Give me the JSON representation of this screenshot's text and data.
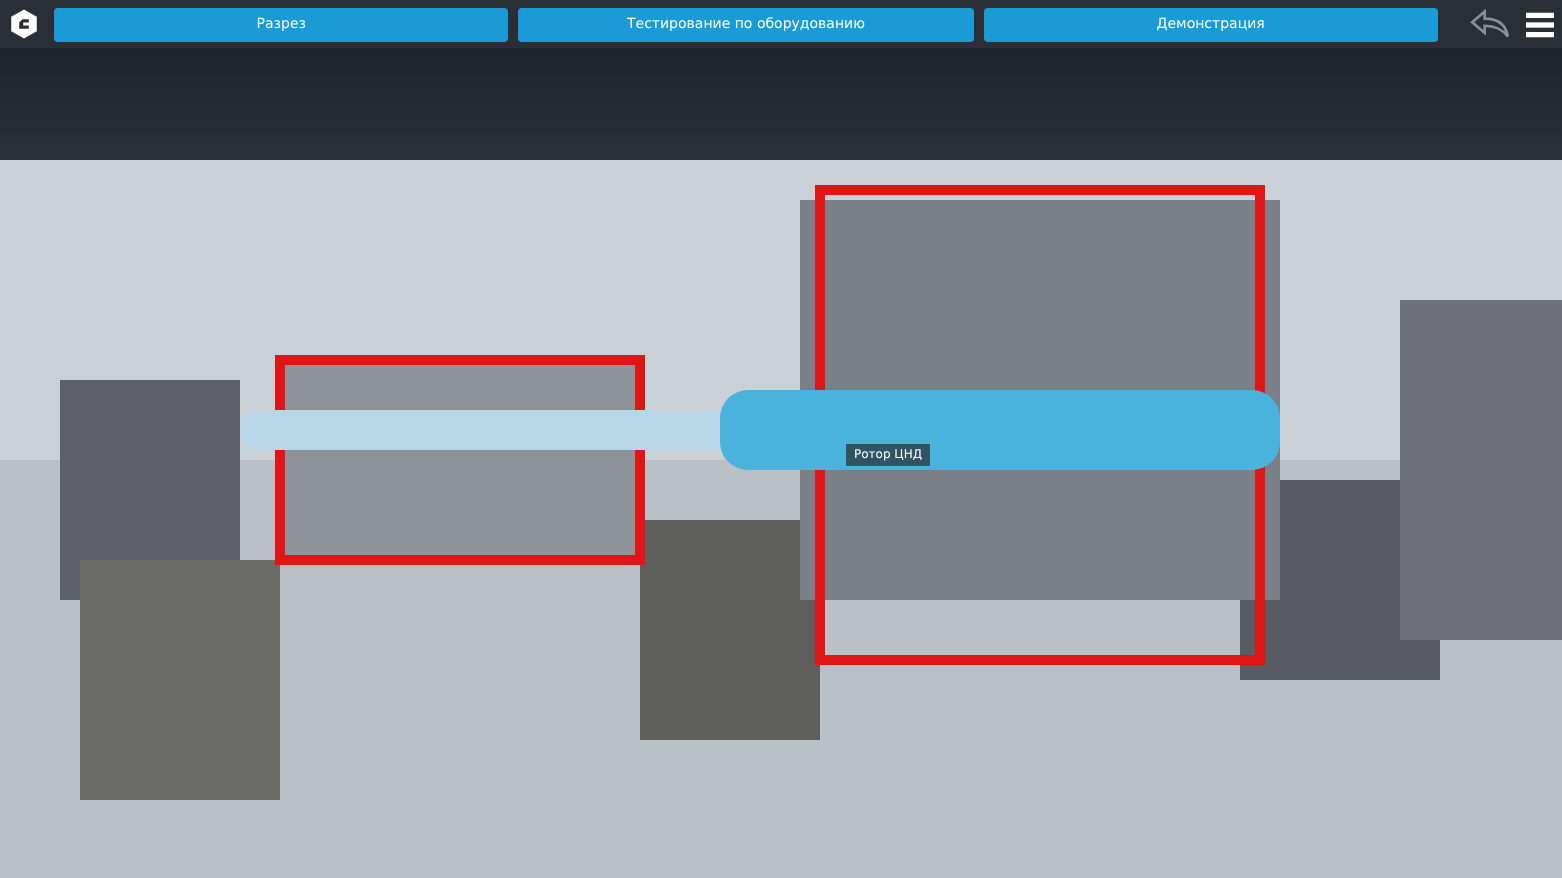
{
  "tabs": [
    {
      "label": "Разрез"
    },
    {
      "label": "Тестирование по оборудованию"
    },
    {
      "label": "Демонстрация"
    }
  ],
  "scene": {
    "callout": "Ротор ЦНД"
  }
}
